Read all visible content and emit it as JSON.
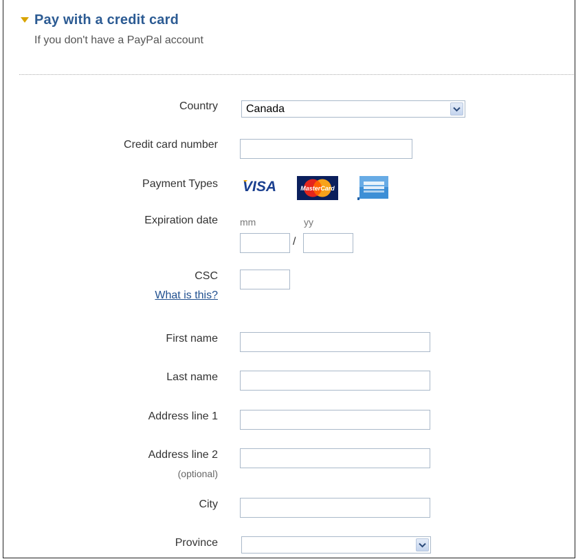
{
  "header": {
    "title": "Pay with a credit card",
    "subtitle": "If you don't have a PayPal account"
  },
  "form": {
    "country": {
      "label": "Country",
      "value": "Canada"
    },
    "card_number": {
      "label": "Credit card number",
      "value": ""
    },
    "payment_types": {
      "label": "Payment Types",
      "cards": [
        {
          "name": "VISA",
          "icon": "visa-logo"
        },
        {
          "name": "MasterCard",
          "icon": "mastercard-logo"
        },
        {
          "name": "American Express",
          "icon": "amex-logo"
        }
      ]
    },
    "expiration": {
      "label": "Expiration date",
      "mm_hint": "mm",
      "yy_hint": "yy",
      "separator": "/"
    },
    "csc": {
      "label": "CSC",
      "help_link": "What is this?"
    },
    "first_name": {
      "label": "First name"
    },
    "last_name": {
      "label": "Last name"
    },
    "address1": {
      "label": "Address line 1"
    },
    "address2": {
      "label": "Address line 2",
      "note": "(optional)"
    },
    "city": {
      "label": "City"
    },
    "province": {
      "label": "Province",
      "value": ""
    }
  },
  "colors": {
    "title": "#2c5b93",
    "arrow": "#d9a400",
    "link": "#1f4f8f",
    "input_border": "#a9b8c9"
  }
}
